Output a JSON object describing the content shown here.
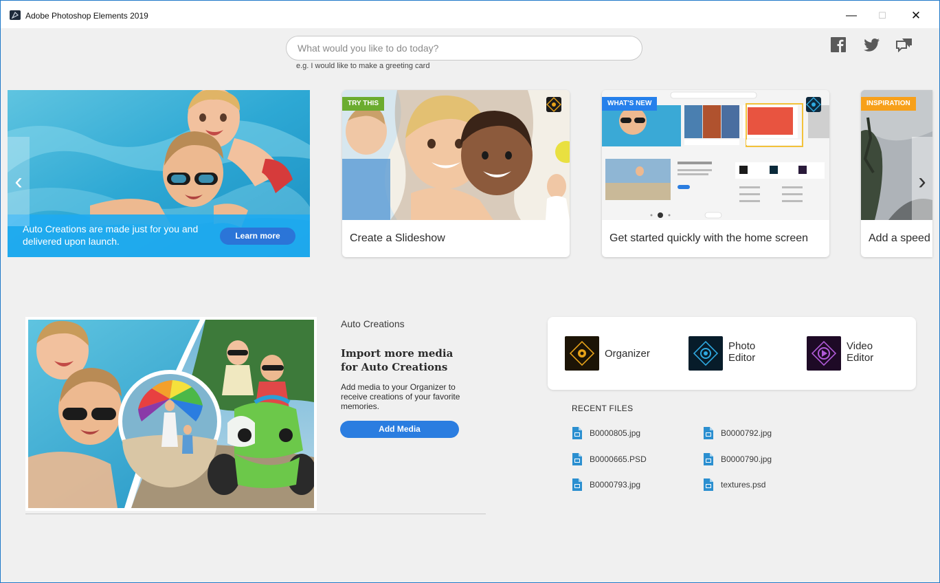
{
  "window": {
    "title": "Adobe Photoshop Elements 2019",
    "minimize_label": "—",
    "maximize_label": "☐",
    "close_label": "✕"
  },
  "search": {
    "placeholder": "What would you like to do today?",
    "hint": "e.g. I would like to make a greeting card"
  },
  "social": {
    "facebook_icon": "facebook-icon",
    "twitter_icon": "twitter-icon",
    "feedback_icon": "feedback-icon"
  },
  "carousel": {
    "hero": {
      "text": "Auto Creations are made just for you and delivered upon launch.",
      "button": "Learn more"
    },
    "cards": [
      {
        "badge": "TRY THIS",
        "caption": "Create a Slideshow"
      },
      {
        "badge": "WHAT'S NEW",
        "caption": "Get started quickly with the home screen"
      },
      {
        "badge": "INSPIRATION",
        "caption": "Add a speed"
      }
    ],
    "prev_label": "‹",
    "next_label": "›"
  },
  "auto_creations": {
    "heading": "Auto Creations",
    "title": "Import more media for Auto Creations",
    "description": "Add media to your Organizer to receive creations of your favorite memories.",
    "button": "Add Media"
  },
  "launchers": [
    {
      "label": "Organizer"
    },
    {
      "label_line1": "Photo",
      "label_line2": "Editor"
    },
    {
      "label_line1": "Video",
      "label_line2": "Editor"
    }
  ],
  "recent_files": {
    "heading": "RECENT FILES",
    "files": [
      "B0000805.jpg",
      "B0000792.jpg",
      "B0000665.PSD",
      "B0000790.jpg",
      "B0000793.jpg",
      "textures.psd"
    ]
  },
  "colors": {
    "accent_blue": "#2b7de0",
    "badge_green": "#6bac2f",
    "badge_blue": "#2680eb",
    "badge_orange": "#f7a01a",
    "window_border": "#1e78c8"
  }
}
